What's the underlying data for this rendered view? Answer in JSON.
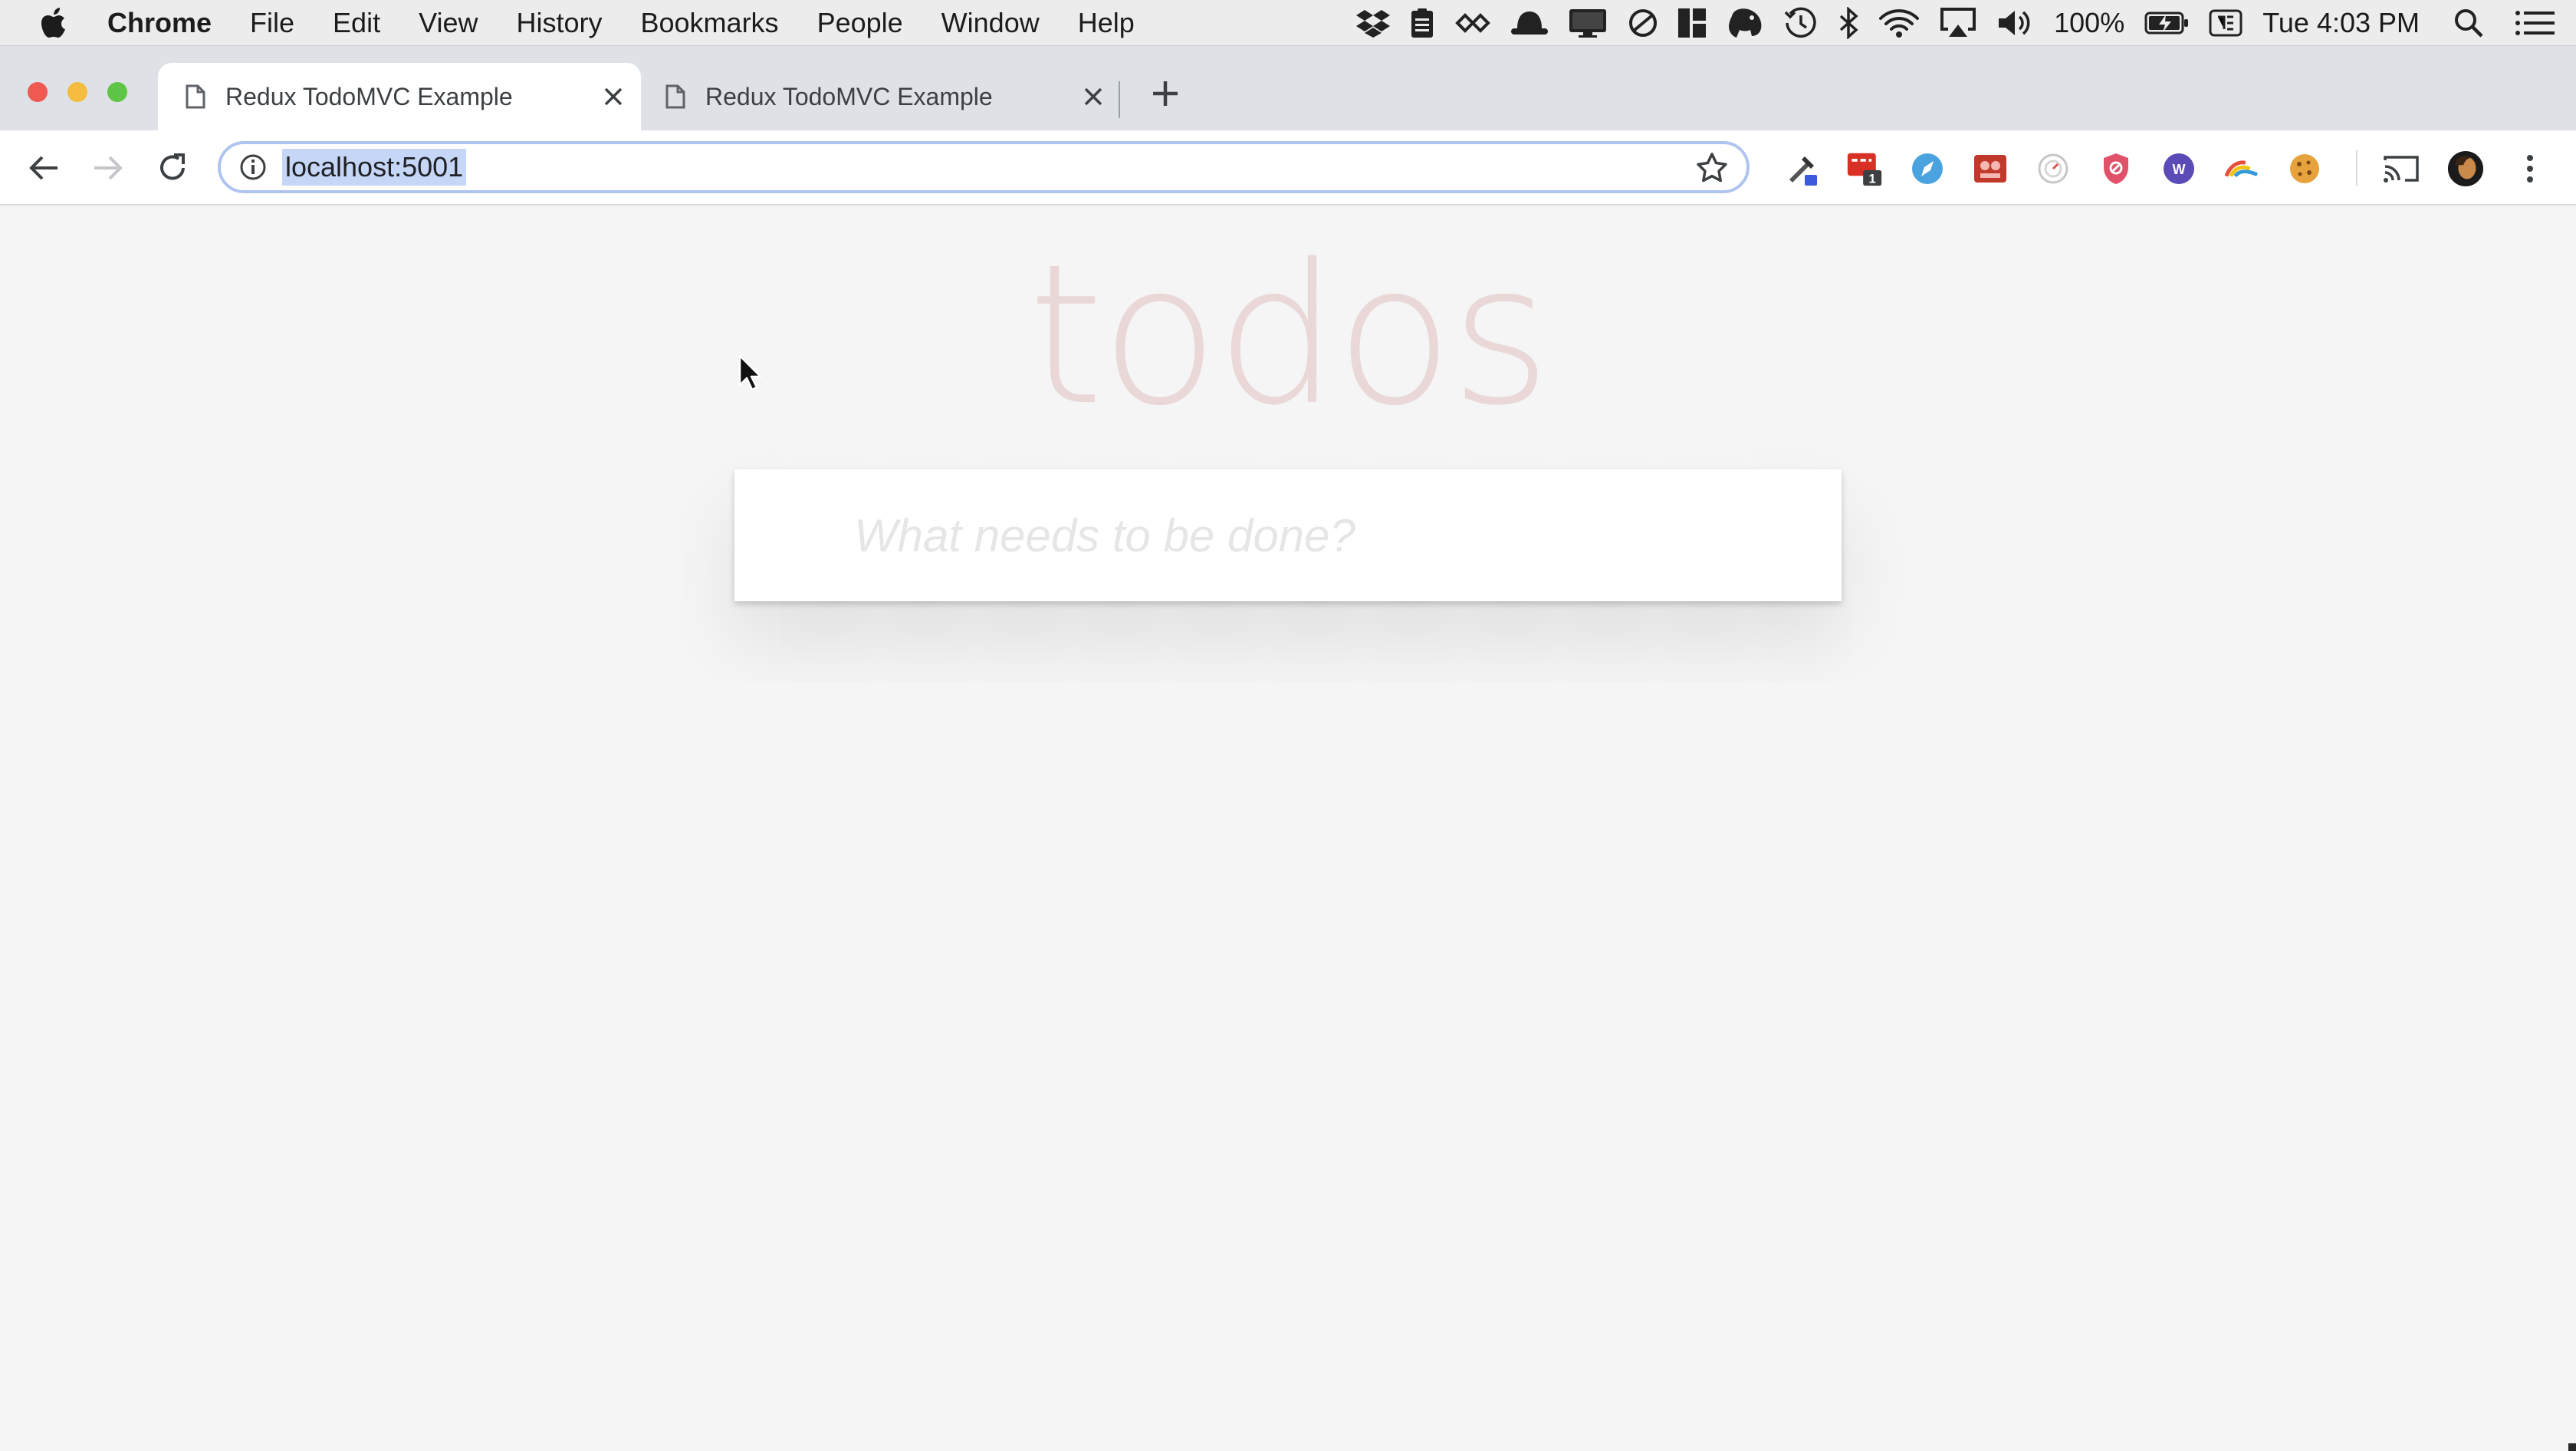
{
  "menubar": {
    "app_name": "Chrome",
    "items": [
      "File",
      "Edit",
      "View",
      "History",
      "Bookmarks",
      "People",
      "Window",
      "Help"
    ],
    "battery": "100%",
    "clock": "Tue 4:03 PM"
  },
  "tabs": [
    {
      "title": "Redux TodoMVC Example",
      "active": true
    },
    {
      "title": "Redux TodoMVC Example",
      "active": false
    }
  ],
  "address_bar": {
    "url": "localhost:5001"
  },
  "extensions": [
    "eyedropper-extension-icon",
    "mail-extension-icon",
    "pen-extension-icon",
    "video-extension-icon",
    "timer-extension-icon",
    "shield-extension-icon",
    "web-extension-icon",
    "rainbow-extension-icon",
    "cookie-extension-icon"
  ],
  "extension_badge": "1",
  "page": {
    "title": "todos",
    "new_todo_placeholder": "What needs to be done?"
  },
  "colors": {
    "page_background": "#f5f5f5",
    "title_color": "rgba(175,47,47,0.15)",
    "url_selection": "#c6d6f7"
  }
}
